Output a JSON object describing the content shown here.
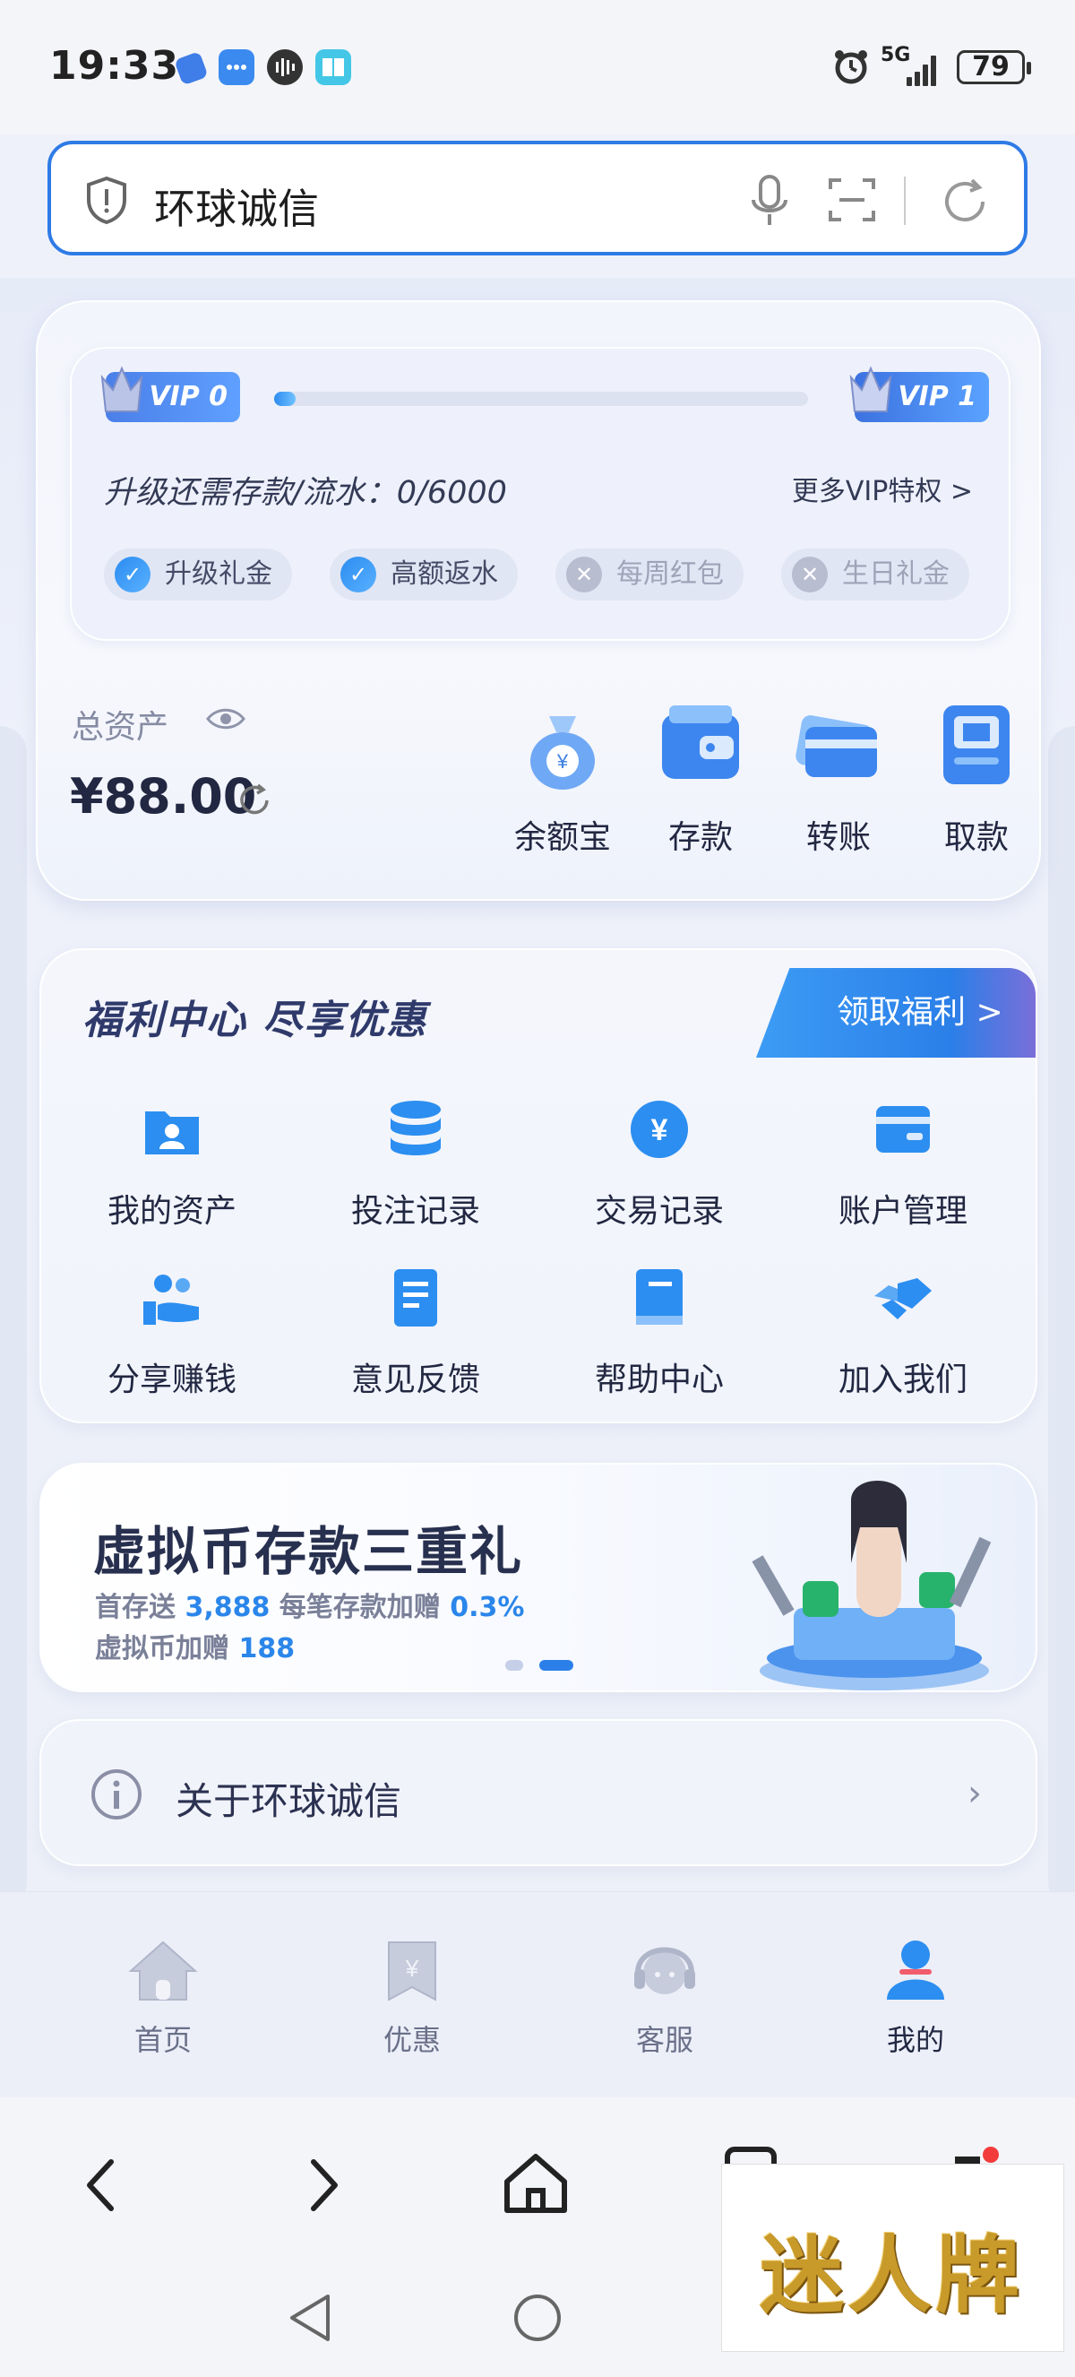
{
  "status_bar": {
    "time": "19:33",
    "network": "5G",
    "battery": "79"
  },
  "address_bar": {
    "text": "环球诚信"
  },
  "vip": {
    "current_level": "VIP 0",
    "next_level": "VIP 1",
    "progress": 0.04,
    "upgrade_text": "升级还需存款/流水：0/6000",
    "more_link": "更多VIP特权 >",
    "privileges": [
      {
        "label": "升级礼金",
        "unlocked": true
      },
      {
        "label": "高额返水",
        "unlocked": true
      },
      {
        "label": "每周红包",
        "unlocked": false
      },
      {
        "label": "生日礼金",
        "unlocked": false
      }
    ]
  },
  "assets": {
    "label": "总资产",
    "amount": "¥88.00"
  },
  "quick_actions": [
    {
      "label": "余额宝",
      "icon": "money-bag-icon"
    },
    {
      "label": "存款",
      "icon": "wallet-icon"
    },
    {
      "label": "转账",
      "icon": "transfer-card-icon"
    },
    {
      "label": "取款",
      "icon": "atm-icon"
    }
  ],
  "welfare": {
    "title": "福利中心  尽享优惠",
    "claim_button": "领取福利 >",
    "items": [
      {
        "label": "我的资产",
        "icon": "person-folder-icon"
      },
      {
        "label": "投注记录",
        "icon": "database-icon"
      },
      {
        "label": "交易记录",
        "icon": "yen-coin-icon"
      },
      {
        "label": "账户管理",
        "icon": "card-icon"
      },
      {
        "label": "分享赚钱",
        "icon": "share-hand-icon"
      },
      {
        "label": "意见反馈",
        "icon": "document-icon"
      },
      {
        "label": "帮助中心",
        "icon": "book-icon"
      },
      {
        "label": "加入我们",
        "icon": "handshake-icon"
      }
    ]
  },
  "banner": {
    "title": "虚拟币存款三重礼",
    "line1_a": "首存送 ",
    "line1_b": "3,888",
    "line1_c": " 每笔存款加赠 ",
    "line1_d": "0.3%",
    "line2_a": "虚拟币加赠 ",
    "line2_b": "188",
    "active_slide": 2,
    "slide_count": 2
  },
  "about": {
    "label": "关于环球诚信"
  },
  "tabbar": [
    {
      "label": "首页",
      "icon": "home-icon",
      "active": false
    },
    {
      "label": "优惠",
      "icon": "coupon-icon",
      "active": false
    },
    {
      "label": "客服",
      "icon": "headset-icon",
      "active": false
    },
    {
      "label": "我的",
      "icon": "user-icon",
      "active": true
    }
  ],
  "watermark": {
    "text": "迷人牌"
  },
  "colors": {
    "accent": "#2e7be6",
    "primary_text": "#222842",
    "muted_text": "#858ba3"
  }
}
